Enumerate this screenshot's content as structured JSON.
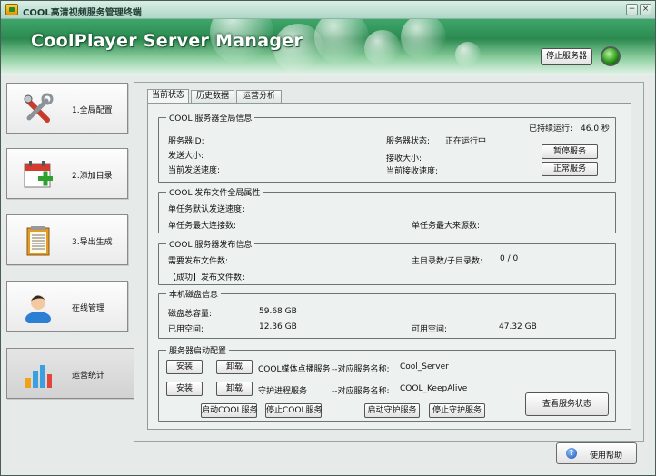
{
  "window": {
    "title": "COOL高清视频服务管理终端",
    "minimize_glyph": "−",
    "close_glyph": "×"
  },
  "banner": {
    "title": "CoolPlayer Server Manager",
    "stop_server_label": "停止服务器",
    "status_color": "#2e9b1d"
  },
  "sidebar": {
    "items": [
      {
        "label": "1.全局配置",
        "icon": "tools-icon"
      },
      {
        "label": "2.添加目录",
        "icon": "calendar-add-icon"
      },
      {
        "label": "3.导出生成",
        "icon": "notepad-icon"
      },
      {
        "label": "在线管理",
        "icon": "user-icon"
      },
      {
        "label": "运营统计",
        "icon": "bar-chart-icon"
      }
    ]
  },
  "tabs": [
    "当前状态",
    "历史数据",
    "运营分析"
  ],
  "global_info": {
    "title": "COOL 服务器全局信息",
    "uptime_label": "已持续运行:",
    "uptime_value": "46.0 秒",
    "server_id_label": "服务器ID:",
    "server_status_label": "服务器状态:",
    "server_status_value": "正在运行中",
    "send_size_label": "发送大小:",
    "recv_size_label": "接收大小:",
    "send_speed_label": "当前发送速度:",
    "recv_speed_label": "当前接收速度:",
    "pause_button": "暂停服务",
    "normal_button": "正常服务"
  },
  "publish_props": {
    "title": "COOL 发布文件全局属性",
    "task_default_speed_label": "单任务默认发送速度:",
    "task_max_conn_label": "单任务最大连接数:",
    "task_max_source_label": "单任务最大来源数:"
  },
  "publish_info": {
    "title": "COOL 服务器发布信息",
    "files_to_publish_label": "需要发布文件数:",
    "dir_count_label": "主目录数/子目录数:",
    "dir_count_value": "0 / 0",
    "published_ok_label": "【成功】发布文件数:"
  },
  "disk_info": {
    "title": "本机磁盘信息",
    "total_label": "磁盘总容量:",
    "total_value": "59.68 GB",
    "used_label": "已用空间:",
    "used_value": "12.36 GB",
    "free_label": "可用空间:",
    "free_value": "47.32 GB"
  },
  "startup_config": {
    "title": "服务器启动配置",
    "rows": [
      {
        "install": "安装",
        "uninstall": "卸载",
        "service": "COOL媒体点播服务",
        "mapping_label": "--对应服务名称:",
        "mapping_value": "Cool_Server"
      },
      {
        "install": "安装",
        "uninstall": "卸载",
        "service": "守护进程服务",
        "mapping_label": "--对应服务名称:",
        "mapping_value": "COOL_KeepAlive"
      }
    ],
    "start_cool": "启动COOL服务",
    "stop_cool": "停止COOL服务",
    "start_guard": "启动守护服务",
    "stop_guard": "停止守护服务",
    "view_status": "查看服务状态"
  },
  "footer": {
    "help_label": "使用帮助"
  }
}
